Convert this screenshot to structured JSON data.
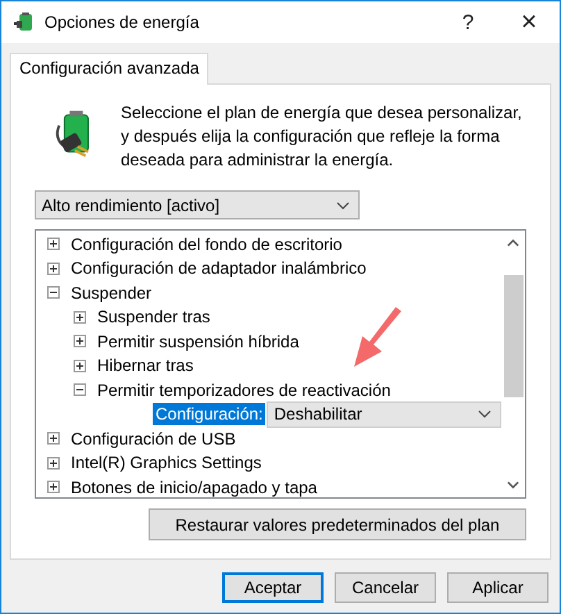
{
  "window": {
    "title": "Opciones de energía",
    "help": "?",
    "close": "×"
  },
  "tabs": [
    {
      "label": "Configuración avanzada",
      "selected": true
    }
  ],
  "description": "Seleccione el plan de energía que desea personalizar, y después elija la configuración que refleje la forma deseada para administrar la energía.",
  "plan_dropdown": {
    "value": "Alto rendimiento [activo]"
  },
  "tree": [
    {
      "label": "Configuración del fondo de escritorio",
      "expanded": false
    },
    {
      "label": "Configuración de adaptador inalámbrico",
      "expanded": false
    },
    {
      "label": "Suspender",
      "expanded": true,
      "children": [
        {
          "label": "Suspender tras",
          "expanded": false
        },
        {
          "label": "Permitir suspensión híbrida",
          "expanded": false
        },
        {
          "label": "Hibernar tras",
          "expanded": false
        },
        {
          "label": "Permitir temporizadores de reactivación",
          "expanded": true,
          "children": [
            {
              "kind": "setting",
              "label": "Configuración:",
              "value": "Deshabilitar",
              "selected": true
            }
          ]
        }
      ]
    },
    {
      "label": "Configuración de USB",
      "expanded": false
    },
    {
      "label": "Intel(R) Graphics Settings",
      "expanded": false
    },
    {
      "label": "Botones de inicio/apagado y tapa",
      "expanded": false
    }
  ],
  "restore_button": "Restaurar valores predeterminados del plan",
  "buttons": [
    {
      "label": "Aceptar",
      "default": true
    },
    {
      "label": "Cancelar",
      "default": false
    },
    {
      "label": "Aplicar",
      "default": false
    }
  ]
}
